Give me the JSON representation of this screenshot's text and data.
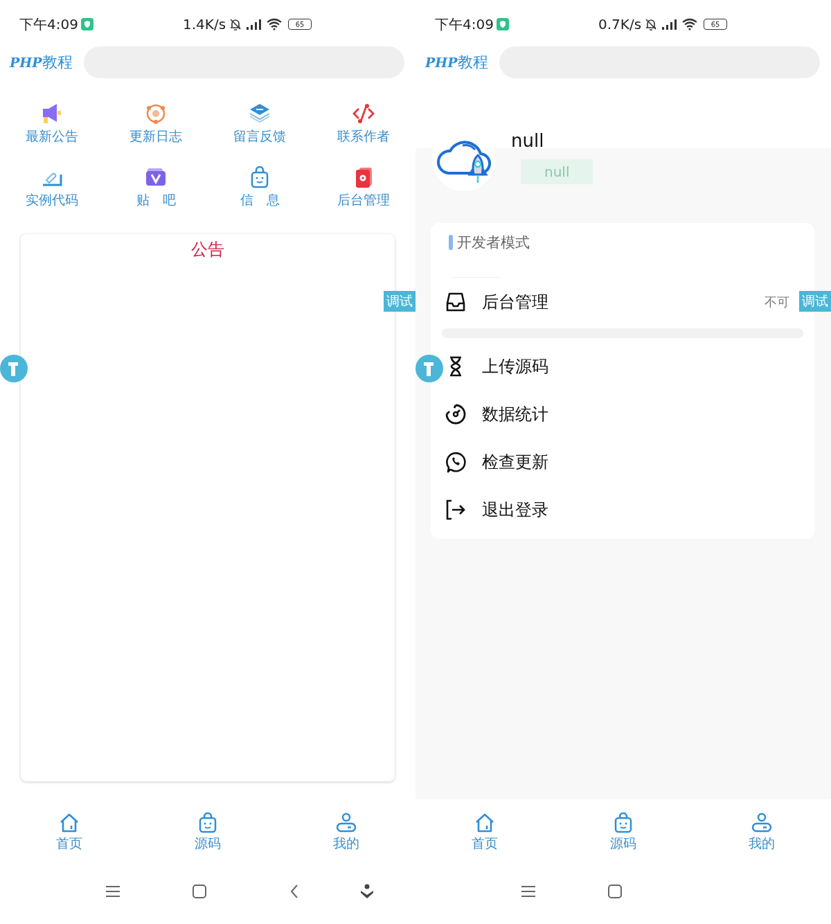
{
  "screens": [
    {
      "kind": "home",
      "status_bar": {
        "time": "下午4:09",
        "speed": "1.4K/s",
        "battery": "65"
      },
      "header": {
        "logo_latin": "PHP",
        "logo_cjk": "教程"
      },
      "grid": [
        {
          "label": "最新公告"
        },
        {
          "label": "更新日志"
        },
        {
          "label": "留言反馈"
        },
        {
          "label": "联系作者"
        },
        {
          "label": "实例代码"
        },
        {
          "label": "贴　吧"
        },
        {
          "label": "信　息"
        },
        {
          "label": "后台管理"
        }
      ],
      "notice": {
        "title": "公告"
      },
      "debug_tab": "调试",
      "bottom_nav": [
        {
          "label": "首页"
        },
        {
          "label": "源码"
        },
        {
          "label": "我的"
        }
      ],
      "system_nav": [
        {
          "kind": "menu"
        },
        {
          "kind": "home"
        },
        {
          "kind": "back"
        },
        {
          "kind": "down"
        }
      ]
    },
    {
      "kind": "profile",
      "status_bar": {
        "time": "下午4:09",
        "speed": "0.7K/s",
        "battery": "65"
      },
      "header": {
        "logo_latin": "PHP",
        "logo_cjk": "教程"
      },
      "profile": {
        "name": "null",
        "badge": "null"
      },
      "menu_title": "开发者模式",
      "menu": [
        {
          "label": "后台管理",
          "note": "不可"
        },
        {
          "label": "上传源码"
        },
        {
          "label": "数据统计"
        },
        {
          "label": "检查更新"
        },
        {
          "label": "退出登录"
        }
      ],
      "debug_tab": "调试",
      "bottom_nav": [
        {
          "label": "首页"
        },
        {
          "label": "源码"
        },
        {
          "label": "我的"
        }
      ],
      "system_nav": [
        {
          "kind": "menu"
        },
        {
          "kind": "home"
        }
      ]
    }
  ]
}
